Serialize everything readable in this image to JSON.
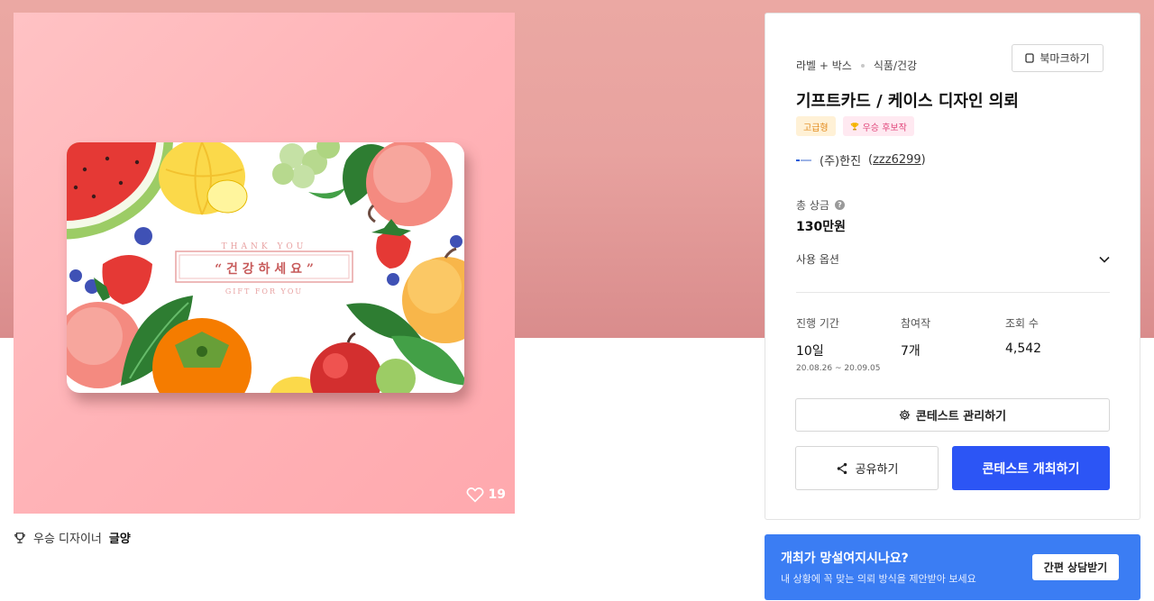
{
  "product": {
    "likes": "19",
    "card": {
      "top_text": "THANK YOU",
      "main_text": "“ 건 강 하 세 요 ”",
      "bottom_text": "GIFT FOR YOU"
    }
  },
  "designer": {
    "prefix": "우승 디자이너",
    "name": "글양"
  },
  "contest": {
    "breadcrumb": [
      "라벨 + 박스",
      "식품/건강"
    ],
    "bookmark_label": "북마크하기",
    "title": "기프트카드 / 케이스 디자인 의뢰",
    "badges": [
      "고급형",
      "우승 후보작"
    ],
    "owner_name": "(주)한진",
    "owner_id": "zzz6299",
    "prize_label": "총 상금",
    "prize_value": "130만원",
    "options_label": "사용 옵션",
    "stats": [
      {
        "label": "진행 기간",
        "value": "10일",
        "sub": "20.08.26 ~ 20.09.05"
      },
      {
        "label": "참여작",
        "value": "7개",
        "sub": ""
      },
      {
        "label": "조회 수",
        "value": "4,542",
        "sub": ""
      }
    ],
    "manage_label": "콘테스트 관리하기",
    "share_label": "공유하기",
    "host_label": "콘테스트 개최하기"
  },
  "consult": {
    "title": "개최가 망설여지시나요?",
    "subtitle": "내 상황에 꼭 맞는 의뢰 방식을 제안받아 보세요",
    "button": "간편 상담받기"
  },
  "colors": {
    "accent_blue": "#2c55f5",
    "consult_blue": "#3b7df3",
    "hero_pink": "#eba8a3"
  }
}
